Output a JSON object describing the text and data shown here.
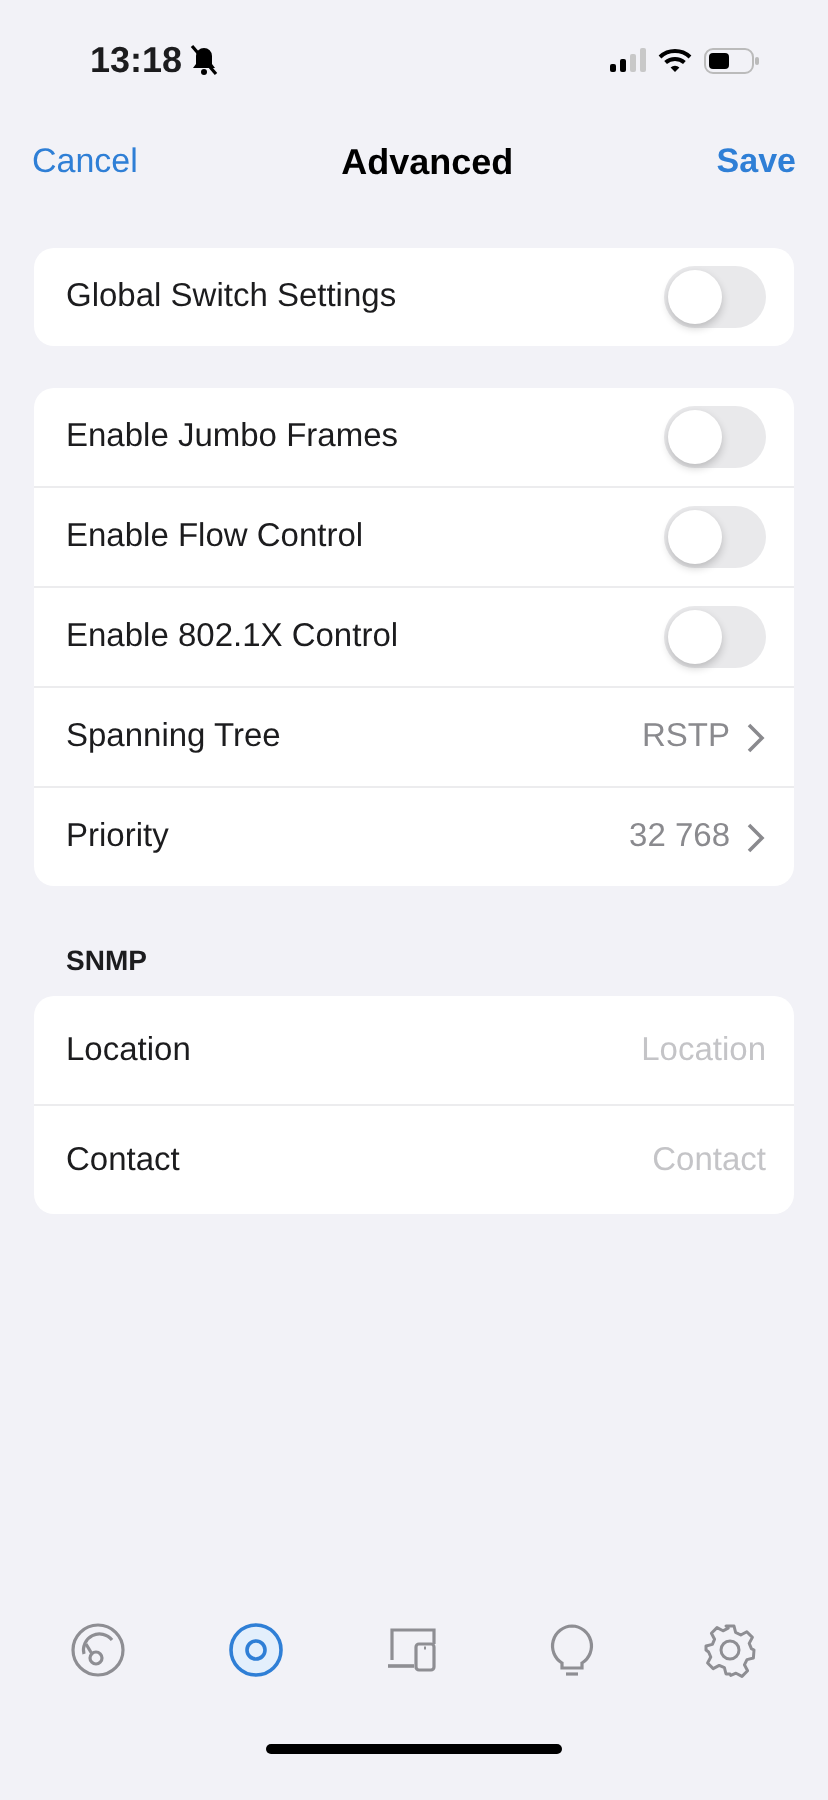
{
  "status_bar": {
    "time": "13:18"
  },
  "nav": {
    "cancel": "Cancel",
    "title": "Advanced",
    "save": "Save"
  },
  "groups": [
    {
      "rows": [
        {
          "kind": "toggle",
          "label": "Global Switch Settings",
          "on": false
        }
      ]
    },
    {
      "rows": [
        {
          "kind": "toggle",
          "label": "Enable Jumbo Frames",
          "on": false
        },
        {
          "kind": "toggle",
          "label": "Enable Flow Control",
          "on": false
        },
        {
          "kind": "toggle",
          "label": "Enable 802.1X Control",
          "on": false
        },
        {
          "kind": "link",
          "label": "Spanning Tree",
          "value": "RSTP"
        },
        {
          "kind": "link",
          "label": "Priority",
          "value": "32 768"
        }
      ]
    },
    {
      "header": "SNMP",
      "rows": [
        {
          "kind": "field",
          "label": "Location",
          "placeholder": "Location"
        },
        {
          "kind": "field",
          "label": "Contact",
          "placeholder": "Contact"
        }
      ]
    }
  ],
  "tab_bar": [
    {
      "selected": false
    },
    {
      "selected": true
    },
    {
      "selected": false
    },
    {
      "selected": false
    },
    {
      "selected": false
    }
  ]
}
